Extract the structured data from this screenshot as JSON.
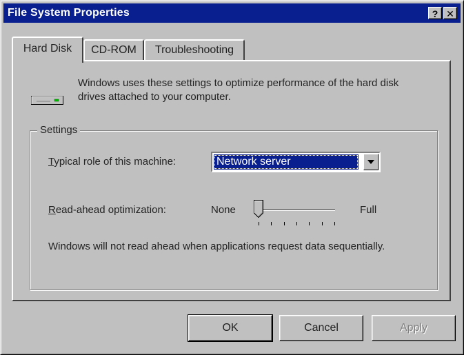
{
  "window": {
    "title": "File System Properties",
    "help_label": "?",
    "close_label": "✕"
  },
  "tabs": [
    {
      "label": "Hard Disk",
      "active": true
    },
    {
      "label": "CD-ROM",
      "active": false
    },
    {
      "label": "Troubleshooting",
      "active": false
    }
  ],
  "hard_disk": {
    "icon": "hard-disk-drive-icon",
    "description": "Windows uses these settings to optimize performance of the hard disk drives attached to your computer.",
    "settings_group_label": "Settings",
    "role_label_mnemonic": "T",
    "role_label_rest": "ypical role of this machine:",
    "role_selected": "Network server",
    "readahead_label_mnemonic": "R",
    "readahead_label_rest": "ead-ahead optimization:",
    "readahead_min_label": "None",
    "readahead_max_label": "Full",
    "readahead_level": 0,
    "readahead_steps": 7,
    "note": "Windows will not read ahead when applications request data sequentially."
  },
  "buttons": {
    "ok_label": "OK",
    "cancel_label": "Cancel",
    "apply_label": "Apply"
  },
  "colors": {
    "titlebar": "#0a1f8f",
    "face": "#c0c0c0",
    "selection": "#0a1f8f"
  }
}
